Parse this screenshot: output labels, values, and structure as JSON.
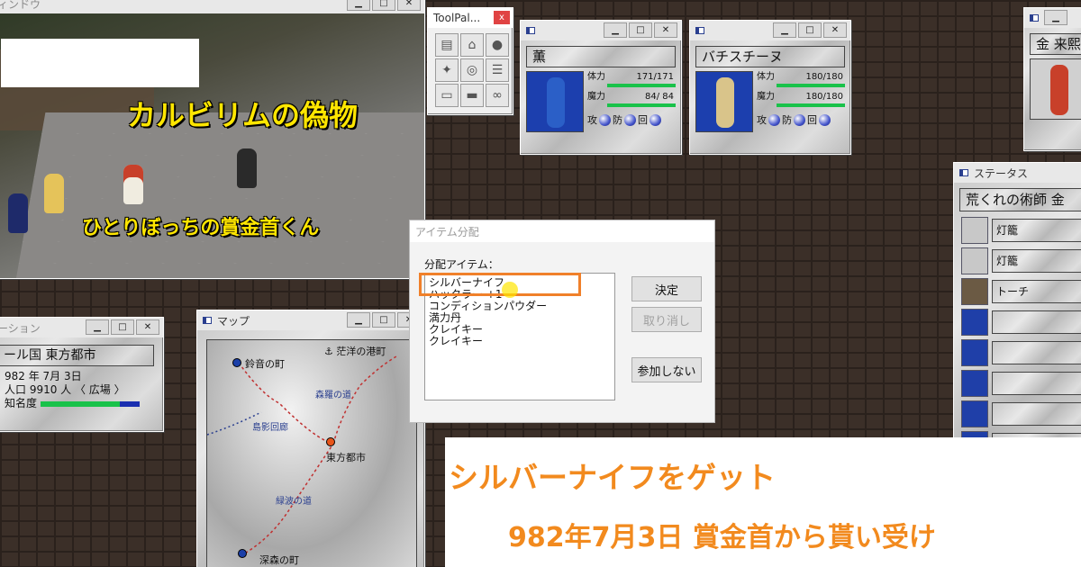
{
  "game_window": {
    "title": "ィンドウ",
    "overlay_title": "カルビリムの偽物",
    "overlay_subtitle": "ひとりぼっちの賞金首くん"
  },
  "tool_palette": {
    "title": "ToolPal...",
    "close": "x",
    "tools": [
      "scroll-icon",
      "house-icon",
      "bag-icon",
      "sparkle-icon",
      "target-icon",
      "list-icon",
      "chest-icon",
      "bed-icon",
      "glasses-icon"
    ]
  },
  "window_buttons": {
    "minimize": "▁",
    "maximize": "□",
    "close": "✕"
  },
  "characters": [
    {
      "name": "薫",
      "hp_label": "体力",
      "hp": "171/171",
      "mp_label": "魔力",
      "mp": "84/ 84",
      "hp_ratio": 1.0,
      "mp_ratio": 1.0,
      "atk": "攻",
      "def": "防",
      "evd": "回",
      "color": "#2b5fc7"
    },
    {
      "name": "バチスチーヌ",
      "hp_label": "体力",
      "hp": "180/180",
      "mp_label": "魔力",
      "mp": "180/180",
      "hp_ratio": 1.0,
      "mp_ratio": 1.0,
      "atk": "攻",
      "def": "防",
      "evd": "回",
      "color": "#d9c48a"
    },
    {
      "name": "金 来熙",
      "color": "#c8402a"
    }
  ],
  "status": {
    "title": "ステータス",
    "character": "荒くれの術師 金",
    "equipment": [
      "灯籠",
      "灯籠",
      "トーチ",
      "",
      "",
      "",
      "",
      ""
    ]
  },
  "location": {
    "title": "ーション",
    "place": "ール国 東方都市",
    "date_line": "982 年  7月 3日",
    "pop_line": "人口  9910 人 〈 広場 〉",
    "fame_label": "知名度",
    "fame_ratio": 0.8
  },
  "map": {
    "title": "マップ",
    "towns": [
      {
        "name": "鈴音の町",
        "color": "#1a3fa8"
      },
      {
        "name": "東方都市",
        "color": "#e8551a"
      },
      {
        "name": "深森の町",
        "color": "#1a3fa8"
      }
    ],
    "port": "茫洋の港町",
    "roads": [
      "森羅の道",
      "島影回廊",
      "緑波の道"
    ]
  },
  "item_dialog": {
    "title": "アイテム分配",
    "label": "分配アイテム：",
    "items": [
      "シルバーナイフ",
      "ハックラー +1",
      "コンディションパウダー",
      "満力丹",
      "クレイキー",
      "クレイキー"
    ],
    "buttons": {
      "confirm": "決定",
      "cancel": "取り消し",
      "skip": "参加しない"
    }
  },
  "banner": {
    "line1": "シルバーナイフをゲット",
    "line2": "982年7月3日 賞金首から貰い受け"
  },
  "colors": {
    "accent_orange": "#f28a1e",
    "overlay_yellow": "#ffe600",
    "bar_green": "#19c24a"
  }
}
